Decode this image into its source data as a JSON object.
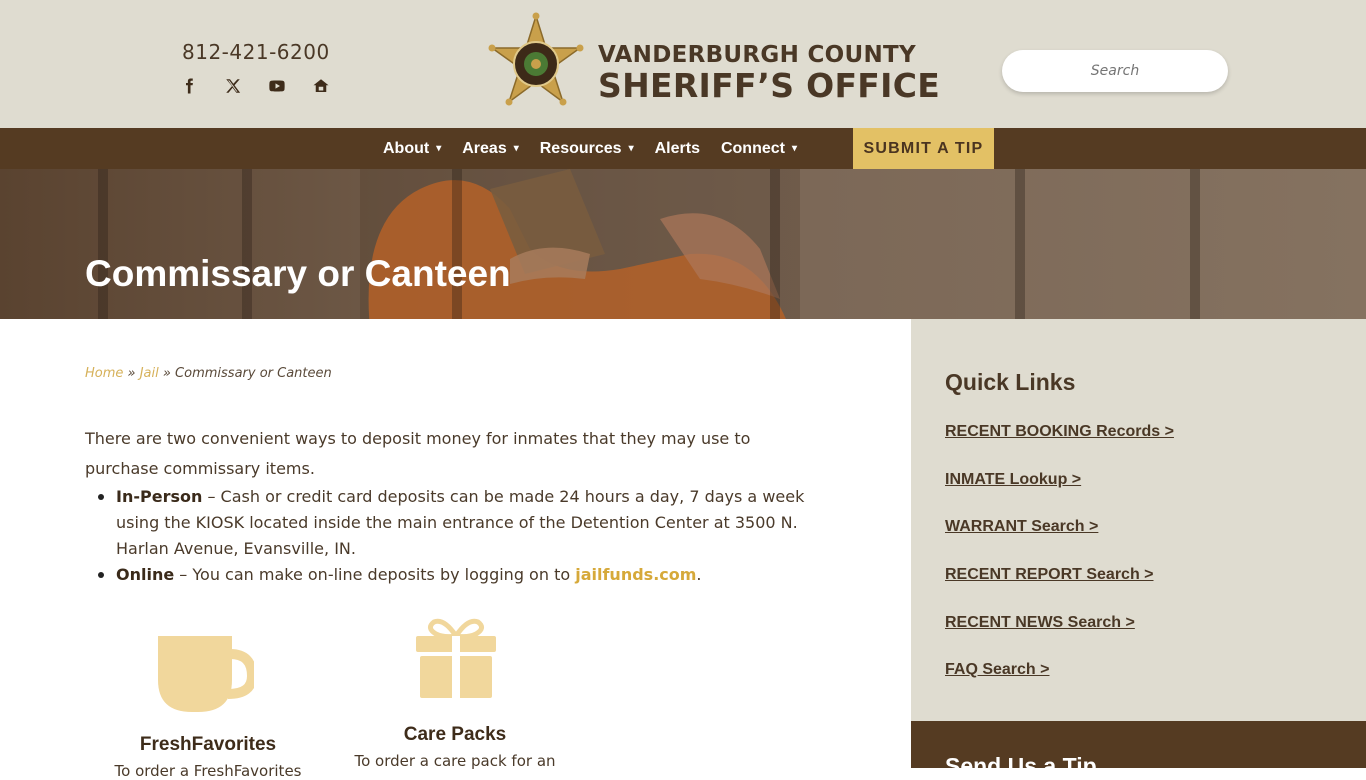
{
  "header": {
    "phone": "812-421-6200",
    "socials": [
      "facebook-icon",
      "x-icon",
      "youtube-icon",
      "nixle-icon"
    ],
    "logo_line1": "VANDERBURGH COUNTY",
    "logo_line2": "SHERIFF’S OFFICE",
    "search_placeholder": "Search"
  },
  "nav": {
    "items": [
      {
        "label": "About",
        "has_dropdown": true
      },
      {
        "label": "Areas",
        "has_dropdown": true
      },
      {
        "label": "Resources",
        "has_dropdown": true
      },
      {
        "label": "Alerts",
        "has_dropdown": false
      },
      {
        "label": "Connect",
        "has_dropdown": true
      }
    ],
    "tip_button": "SUBMIT A TIP"
  },
  "hero": {
    "title": "Commissary or Canteen"
  },
  "breadcrumb": {
    "home": "Home",
    "sep1": "»",
    "jail": "Jail",
    "sep2": "»",
    "current": "Commissary or Canteen"
  },
  "content": {
    "intro": "There are two convenient ways to deposit money for inmates that they may use to purchase commissary items.",
    "items": [
      {
        "label": "In-Person",
        "text": " – Cash or credit card deposits can be made 24 hours a day, 7 days a week using the KIOSK located inside the main entrance of the Detention Center at 3500 N. Harlan Avenue, Evansville, IN."
      },
      {
        "label": "Online",
        "text": " – You can make on-line deposits by logging on to ",
        "link": "jailfunds.com",
        "after": "."
      }
    ],
    "features": [
      {
        "title": "FreshFavorites",
        "desc": "To order a FreshFavorites",
        "icon": "coffee-cup-icon"
      },
      {
        "title": "Care Packs",
        "desc": "To order a care pack for an",
        "icon": "gift-icon"
      }
    ]
  },
  "sidebar": {
    "title": "Quick Links",
    "links": [
      "RECENT BOOKING Records >",
      "INMATE Lookup >",
      "WARRANT Search >",
      "RECENT REPORT Search >",
      "RECENT NEWS Search >",
      "FAQ Search >"
    ],
    "tip_title": "Send Us a Tip"
  },
  "colors": {
    "header_bg": "#dfdcd0",
    "nav_bg": "#553b22",
    "accent_gold": "#e3c165",
    "text_brown": "#4a3826"
  }
}
